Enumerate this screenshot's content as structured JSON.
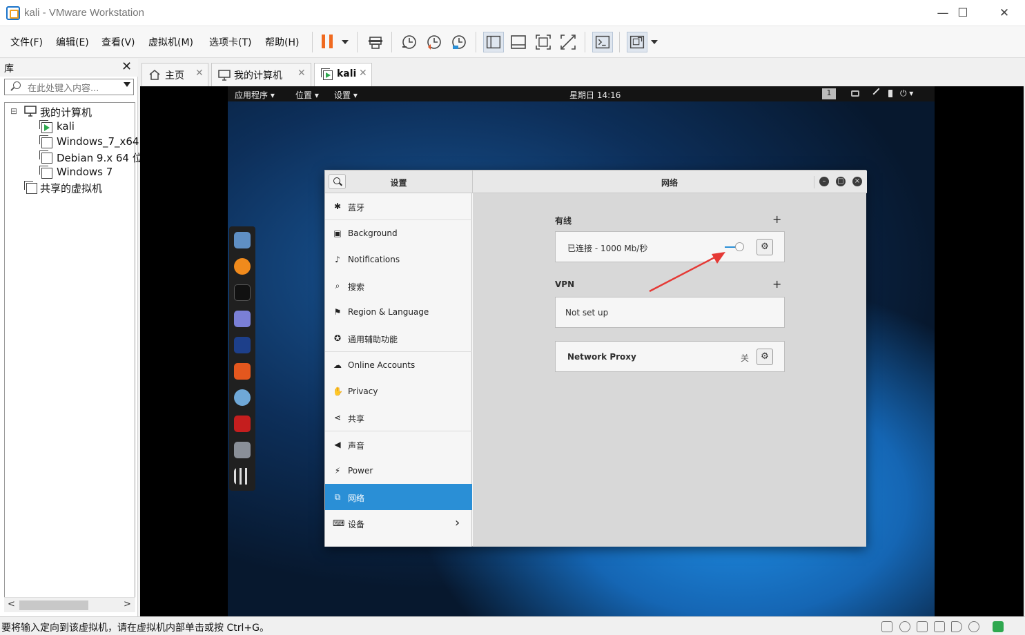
{
  "window": {
    "title": "kali - VMware Workstation",
    "minimize": "—",
    "maximize": "☐",
    "close": "✕"
  },
  "menu": [
    "文件(F)",
    "编辑(E)",
    "查看(V)",
    "虚拟机(M)",
    "选项卡(T)",
    "帮助(H)"
  ],
  "library": {
    "title": "库",
    "close": "✕",
    "search_placeholder": "在此处键入内容...",
    "tree": {
      "root": "我的计算机",
      "collapse": "⊟",
      "vms": [
        "kali",
        "Windows_7_x64",
        "Debian 9.x 64 位",
        "Windows 7"
      ],
      "shared": "共享的虚拟机"
    },
    "scroll_left": "<",
    "scroll_right": ">"
  },
  "tabs": [
    {
      "label": "主页",
      "close": "✕"
    },
    {
      "label": "我的计算机",
      "close": "✕"
    },
    {
      "label": "kali",
      "close": "✕"
    }
  ],
  "gnome": {
    "apps": "应用程序 ▾",
    "places": "位置 ▾",
    "settings_menu": "设置 ▾",
    "clock": "星期日 14:16",
    "workspace": "1",
    "power": "⏻ ▾"
  },
  "settings": {
    "sidebar_title": "设置",
    "main_title": "网络",
    "items": [
      {
        "icon": "✱",
        "label": "蓝牙"
      },
      {
        "icon": "▣",
        "label": "Background"
      },
      {
        "icon": "♪",
        "label": "Notifications"
      },
      {
        "icon": "⌕",
        "label": "搜索"
      },
      {
        "icon": "⚑",
        "label": "Region & Language"
      },
      {
        "icon": "✪",
        "label": "通用辅助功能"
      },
      {
        "icon": "☁",
        "label": "Online Accounts"
      },
      {
        "icon": "✋",
        "label": "Privacy"
      },
      {
        "icon": "⋖",
        "label": "共享"
      },
      {
        "icon": "◀",
        "label": "声音"
      },
      {
        "icon": "⚡",
        "label": "Power"
      },
      {
        "icon": "⧉",
        "label": "网络"
      },
      {
        "icon": "⌨",
        "label": "设备"
      }
    ],
    "selected": "网络",
    "chevron": "›",
    "wired_title": "有线",
    "wired_status": "已连接 - 1000 Mb/秒",
    "wired_enabled": true,
    "vpn_title": "VPN",
    "vpn_status": "Not set up",
    "proxy_label": "Network Proxy",
    "proxy_state": "关",
    "add": "+",
    "gear": "⚙"
  },
  "statusbar": {
    "text": "要将输入定向到该虚拟机，请在虚拟机内部单击或按 Ctrl+G。"
  },
  "colors": {
    "accent": "#2a8fd6",
    "annotation_arrow": "#e53935",
    "pause": "#f06a20"
  }
}
